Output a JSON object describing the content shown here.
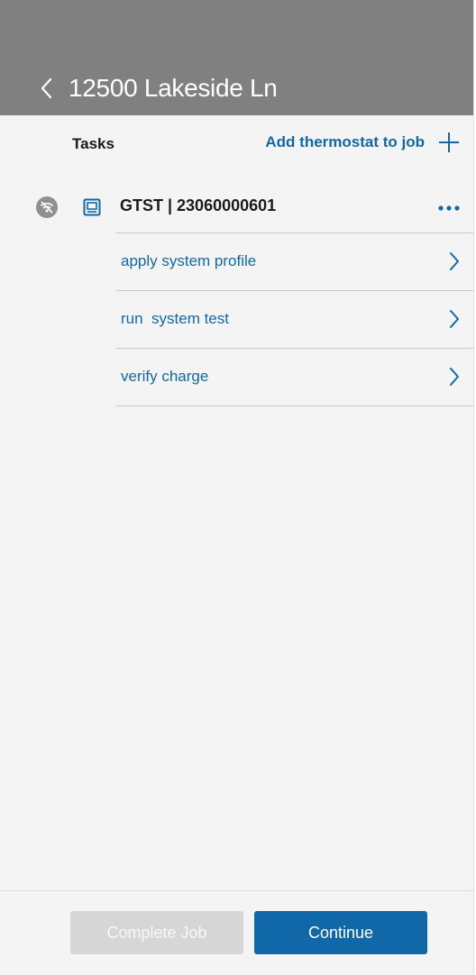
{
  "header": {
    "title": "12500 Lakeside Ln",
    "back_icon": "chevron-left-icon",
    "background_color": "#808080"
  },
  "tasks_bar": {
    "label": "Tasks",
    "add_label": "Add thermostat to job",
    "add_icon": "plus-icon"
  },
  "device": {
    "status_icon": "wifi-off-icon",
    "type_icon": "thermostat-icon",
    "name": "GTST | 23060000601",
    "menu_icon": "more-horizontal-icon"
  },
  "task_list": [
    {
      "label": "apply system profile"
    },
    {
      "label": "run  system test"
    },
    {
      "label": "verify charge"
    }
  ],
  "footer": {
    "complete_label": "Complete Job",
    "complete_enabled": false,
    "continue_label": "Continue"
  },
  "colors": {
    "accent": "#1168a8",
    "header": "#808080",
    "disabled": "#d6d6d6",
    "background": "#f4f4f4"
  }
}
